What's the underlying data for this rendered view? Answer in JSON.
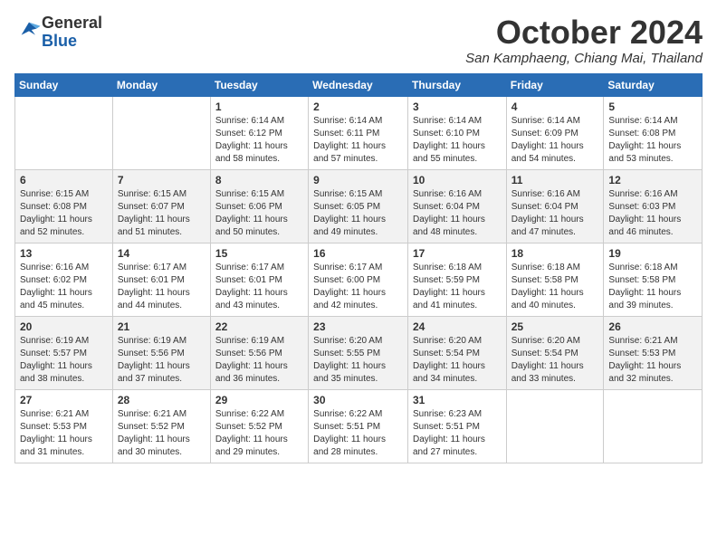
{
  "header": {
    "logo_line1": "General",
    "logo_line2": "Blue",
    "month_title": "October 2024",
    "location": "San Kamphaeng, Chiang Mai, Thailand"
  },
  "weekdays": [
    "Sunday",
    "Monday",
    "Tuesday",
    "Wednesday",
    "Thursday",
    "Friday",
    "Saturday"
  ],
  "weeks": [
    [
      {
        "day": "",
        "info": ""
      },
      {
        "day": "",
        "info": ""
      },
      {
        "day": "1",
        "info": "Sunrise: 6:14 AM\nSunset: 6:12 PM\nDaylight: 11 hours and 58 minutes."
      },
      {
        "day": "2",
        "info": "Sunrise: 6:14 AM\nSunset: 6:11 PM\nDaylight: 11 hours and 57 minutes."
      },
      {
        "day": "3",
        "info": "Sunrise: 6:14 AM\nSunset: 6:10 PM\nDaylight: 11 hours and 55 minutes."
      },
      {
        "day": "4",
        "info": "Sunrise: 6:14 AM\nSunset: 6:09 PM\nDaylight: 11 hours and 54 minutes."
      },
      {
        "day": "5",
        "info": "Sunrise: 6:14 AM\nSunset: 6:08 PM\nDaylight: 11 hours and 53 minutes."
      }
    ],
    [
      {
        "day": "6",
        "info": "Sunrise: 6:15 AM\nSunset: 6:08 PM\nDaylight: 11 hours and 52 minutes."
      },
      {
        "day": "7",
        "info": "Sunrise: 6:15 AM\nSunset: 6:07 PM\nDaylight: 11 hours and 51 minutes."
      },
      {
        "day": "8",
        "info": "Sunrise: 6:15 AM\nSunset: 6:06 PM\nDaylight: 11 hours and 50 minutes."
      },
      {
        "day": "9",
        "info": "Sunrise: 6:15 AM\nSunset: 6:05 PM\nDaylight: 11 hours and 49 minutes."
      },
      {
        "day": "10",
        "info": "Sunrise: 6:16 AM\nSunset: 6:04 PM\nDaylight: 11 hours and 48 minutes."
      },
      {
        "day": "11",
        "info": "Sunrise: 6:16 AM\nSunset: 6:04 PM\nDaylight: 11 hours and 47 minutes."
      },
      {
        "day": "12",
        "info": "Sunrise: 6:16 AM\nSunset: 6:03 PM\nDaylight: 11 hours and 46 minutes."
      }
    ],
    [
      {
        "day": "13",
        "info": "Sunrise: 6:16 AM\nSunset: 6:02 PM\nDaylight: 11 hours and 45 minutes."
      },
      {
        "day": "14",
        "info": "Sunrise: 6:17 AM\nSunset: 6:01 PM\nDaylight: 11 hours and 44 minutes."
      },
      {
        "day": "15",
        "info": "Sunrise: 6:17 AM\nSunset: 6:01 PM\nDaylight: 11 hours and 43 minutes."
      },
      {
        "day": "16",
        "info": "Sunrise: 6:17 AM\nSunset: 6:00 PM\nDaylight: 11 hours and 42 minutes."
      },
      {
        "day": "17",
        "info": "Sunrise: 6:18 AM\nSunset: 5:59 PM\nDaylight: 11 hours and 41 minutes."
      },
      {
        "day": "18",
        "info": "Sunrise: 6:18 AM\nSunset: 5:58 PM\nDaylight: 11 hours and 40 minutes."
      },
      {
        "day": "19",
        "info": "Sunrise: 6:18 AM\nSunset: 5:58 PM\nDaylight: 11 hours and 39 minutes."
      }
    ],
    [
      {
        "day": "20",
        "info": "Sunrise: 6:19 AM\nSunset: 5:57 PM\nDaylight: 11 hours and 38 minutes."
      },
      {
        "day": "21",
        "info": "Sunrise: 6:19 AM\nSunset: 5:56 PM\nDaylight: 11 hours and 37 minutes."
      },
      {
        "day": "22",
        "info": "Sunrise: 6:19 AM\nSunset: 5:56 PM\nDaylight: 11 hours and 36 minutes."
      },
      {
        "day": "23",
        "info": "Sunrise: 6:20 AM\nSunset: 5:55 PM\nDaylight: 11 hours and 35 minutes."
      },
      {
        "day": "24",
        "info": "Sunrise: 6:20 AM\nSunset: 5:54 PM\nDaylight: 11 hours and 34 minutes."
      },
      {
        "day": "25",
        "info": "Sunrise: 6:20 AM\nSunset: 5:54 PM\nDaylight: 11 hours and 33 minutes."
      },
      {
        "day": "26",
        "info": "Sunrise: 6:21 AM\nSunset: 5:53 PM\nDaylight: 11 hours and 32 minutes."
      }
    ],
    [
      {
        "day": "27",
        "info": "Sunrise: 6:21 AM\nSunset: 5:53 PM\nDaylight: 11 hours and 31 minutes."
      },
      {
        "day": "28",
        "info": "Sunrise: 6:21 AM\nSunset: 5:52 PM\nDaylight: 11 hours and 30 minutes."
      },
      {
        "day": "29",
        "info": "Sunrise: 6:22 AM\nSunset: 5:52 PM\nDaylight: 11 hours and 29 minutes."
      },
      {
        "day": "30",
        "info": "Sunrise: 6:22 AM\nSunset: 5:51 PM\nDaylight: 11 hours and 28 minutes."
      },
      {
        "day": "31",
        "info": "Sunrise: 6:23 AM\nSunset: 5:51 PM\nDaylight: 11 hours and 27 minutes."
      },
      {
        "day": "",
        "info": ""
      },
      {
        "day": "",
        "info": ""
      }
    ]
  ]
}
